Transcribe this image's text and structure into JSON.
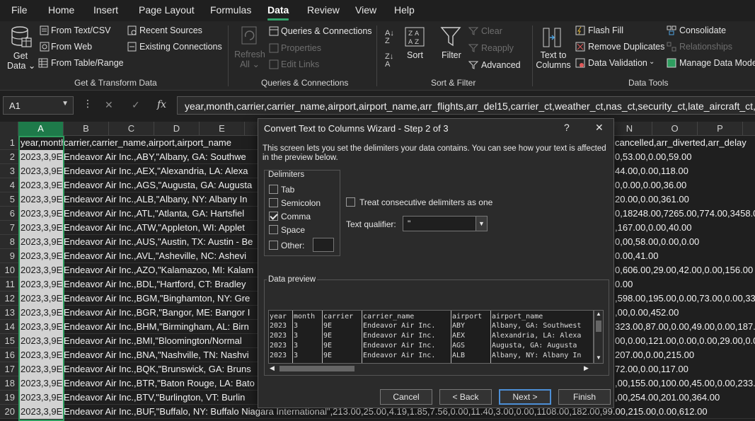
{
  "menu": {
    "items": [
      "File",
      "Home",
      "Insert",
      "Page Layout",
      "Formulas",
      "Data",
      "Review",
      "View",
      "Help"
    ],
    "active": "Data"
  },
  "ribbon": {
    "get_transform": {
      "get_data": "Get",
      "get_data2": "Data",
      "from_text": "From Text/CSV",
      "from_web": "From Web",
      "from_table": "From Table/Range",
      "recent_sources": "Recent Sources",
      "existing_connections": "Existing Connections",
      "label": "Get & Transform Data"
    },
    "queries": {
      "refresh_all": "Refresh",
      "refresh_all2": "All",
      "queries_connections": "Queries & Connections",
      "properties": "Properties",
      "edit_links": "Edit Links",
      "label": "Queries & Connections"
    },
    "sort_filter": {
      "sort": "Sort",
      "filter": "Filter",
      "clear": "Clear",
      "reapply": "Reapply",
      "advanced": "Advanced",
      "label": "Sort & Filter"
    },
    "data_tools": {
      "text_to_columns": "Text to",
      "text_to_columns2": "Columns",
      "flash_fill": "Flash Fill",
      "remove_duplicates": "Remove Duplicates",
      "data_validation": "Data Validation",
      "consolidate": "Consolidate",
      "relationships": "Relationships",
      "manage_data_model": "Manage Data Model",
      "label": "Data Tools"
    }
  },
  "formula_bar": {
    "name_box": "A1",
    "fx": "fx",
    "formula": "year,month,carrier,carrier_name,airport,airport_name,arr_flights,arr_del15,carrier_ct,weather_ct,nas_ct,security_ct,late_aircraft_ct,"
  },
  "grid": {
    "columns": [
      "A",
      "B",
      "C",
      "D",
      "E",
      "N",
      "O",
      "P"
    ],
    "rows": [
      {
        "n": "1",
        "a": "year,month",
        "left": "carrier,carrier_name,airport,airport_name",
        "right": "cancelled,arr_diverted,arr_delay"
      },
      {
        "n": "2",
        "a": "2023,3,9E,",
        "left": "Endeavor Air Inc.,ABY,\"Albany, GA: Southwe",
        "right": "0,53.00,0.00,59.00"
      },
      {
        "n": "3",
        "a": "2023,3,9E,",
        "left": "Endeavor Air Inc.,AEX,\"Alexandria, LA: Alexa",
        "right": "44.00,0.00,118.00"
      },
      {
        "n": "4",
        "a": "2023,3,9E,",
        "left": "Endeavor Air Inc.,AGS,\"Augusta, GA: Augusta",
        "right": "0,0.00,0.00,36.00"
      },
      {
        "n": "5",
        "a": "2023,3,9E,",
        "left": "Endeavor Air Inc.,ALB,\"Albany, NY: Albany In",
        "right": "20.00,0.00,361.00"
      },
      {
        "n": "6",
        "a": "2023,3,9E,",
        "left": "Endeavor Air Inc.,ATL,\"Atlanta, GA: Hartsfiel",
        "right": "0,18248.00,7265.00,774.00,3458.0"
      },
      {
        "n": "7",
        "a": "2023,3,9E,",
        "left": "Endeavor Air Inc.,ATW,\"Appleton, WI: Applet",
        "right": ",167.00,0.00,40.00"
      },
      {
        "n": "8",
        "a": "2023,3,9E,",
        "left": "Endeavor Air Inc.,AUS,\"Austin, TX: Austin - Be",
        "right": "0,00,58.00,0.00,0.00"
      },
      {
        "n": "9",
        "a": "2023,3,9E,",
        "left": "Endeavor Air Inc.,AVL,\"Asheville, NC: Ashevi",
        "right": "0.00,41.00"
      },
      {
        "n": "10",
        "a": "2023,3,9E,",
        "left": "Endeavor Air Inc.,AZO,\"Kalamazoo, MI: Kalam",
        "right": "0,606.00,29.00,42.00,0.00,156.00"
      },
      {
        "n": "11",
        "a": "2023,3,9E,",
        "left": "Endeavor Air Inc.,BDL,\"Hartford, CT: Bradley",
        "right": "0.00"
      },
      {
        "n": "12",
        "a": "2023,3,9E,",
        "left": "Endeavor Air Inc.,BGM,\"Binghamton, NY: Gre",
        "right": ",598.00,195.00,0.00,73.00,0.00,33"
      },
      {
        "n": "13",
        "a": "2023,3,9E,",
        "left": "Endeavor Air Inc.,BGR,\"Bangor, ME: Bangor I",
        "right": ",00,0.00,452.00"
      },
      {
        "n": "14",
        "a": "2023,3,9E,",
        "left": "Endeavor Air Inc.,BHM,\"Birmingham, AL: Birn",
        "right": "323.00,87.00,0.00,49.00,0.00,187."
      },
      {
        "n": "15",
        "a": "2023,3,9E,",
        "left": "Endeavor Air Inc.,BMI,\"Bloomington/Normal",
        "right": "00,0.00,121.00,0.00,0.00,29.00,0.0"
      },
      {
        "n": "16",
        "a": "2023,3,9E,",
        "left": "Endeavor Air Inc.,BNA,\"Nashville, TN: Nashvi",
        "right": "207.00,0.00,215.00"
      },
      {
        "n": "17",
        "a": "2023,3,9E,",
        "left": "Endeavor Air Inc.,BQK,\"Brunswick, GA: Bruns",
        "right": "72.00,0.00,117.00"
      },
      {
        "n": "18",
        "a": "2023,3,9E,",
        "left": "Endeavor Air Inc.,BTR,\"Baton Rouge, LA: Bato",
        "right": ",00,155.00,100.00,45.00,0.00,233."
      },
      {
        "n": "19",
        "a": "2023,3,9E,",
        "left": "Endeavor Air Inc.,BTV,\"Burlington, VT: Burlin",
        "right": ",00,254.00,201.00,364.00"
      },
      {
        "n": "20",
        "a": "2023,3,9E,",
        "left": "Endeavor Air Inc.,BUF,\"Buffalo, NY: Buffalo Niagara International\",213.00,25.00,4.19,1.85,7.56,0.00,11.40,3.00,0.00,1108.00,182.00,99.00,215.00,0.00,612.00",
        "right": ""
      }
    ]
  },
  "dialog": {
    "title": "Convert Text to Columns Wizard - Step 2 of 3",
    "help": "?",
    "close": "✕",
    "description": "This screen lets you set the delimiters your data contains.  You can see how your text is affected in the preview below.",
    "delimiters_label": "Delimiters",
    "delimiters": [
      {
        "label": "Tab",
        "checked": false
      },
      {
        "label": "Semicolon",
        "checked": false
      },
      {
        "label": "Comma",
        "checked": true
      },
      {
        "label": "Space",
        "checked": false
      },
      {
        "label": "Other:",
        "checked": false
      }
    ],
    "treat_consecutive": "Treat consecutive delimiters as one",
    "text_qualifier_label": "Text qualifier:",
    "text_qualifier_value": "\"",
    "preview_label": "Data preview",
    "preview": {
      "headers": [
        "year",
        "month",
        "carrier",
        "carrier_name",
        "airport",
        "airport_name"
      ],
      "rows": [
        [
          "2023",
          "3",
          "9E",
          "Endeavor Air Inc.",
          "ABY",
          "Albany, GA: Southwest"
        ],
        [
          "2023",
          "3",
          "9E",
          "Endeavor Air Inc.",
          "AEX",
          "Alexandria, LA: Alexa"
        ],
        [
          "2023",
          "3",
          "9E",
          "Endeavor Air Inc.",
          "AGS",
          "Augusta, GA: Augusta"
        ],
        [
          "2023",
          "3",
          "9E",
          "Endeavor Air Inc.",
          "ALB",
          "Albany, NY: Albany In"
        ]
      ]
    },
    "buttons": {
      "cancel": "Cancel",
      "back": "< Back",
      "next": "Next >",
      "finish": "Finish"
    }
  }
}
